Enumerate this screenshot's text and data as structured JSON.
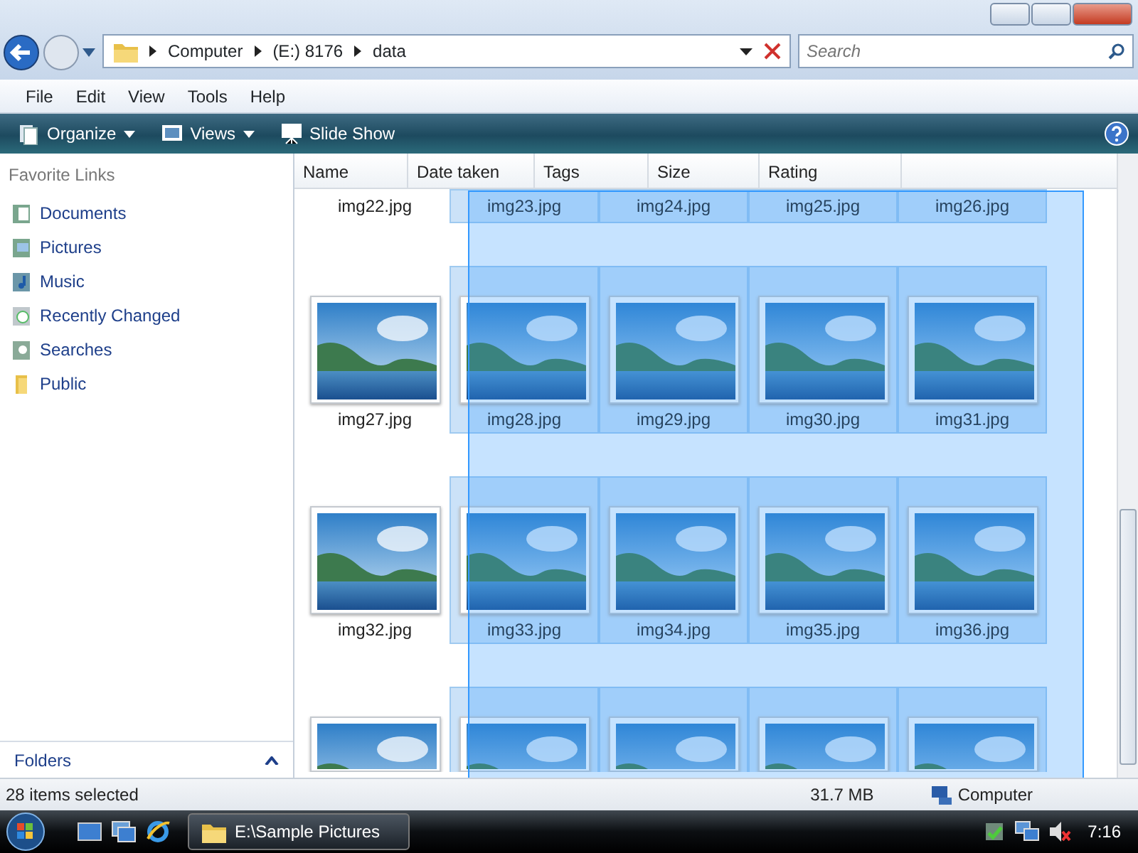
{
  "address_bar": {
    "crumbs": [
      "Computer",
      "(E:) 8176",
      "data"
    ]
  },
  "search": {
    "placeholder": "Search"
  },
  "menu": [
    "File",
    "Edit",
    "View",
    "Tools",
    "Help"
  ],
  "toolbar": [
    "Organize",
    "Views",
    "Slide Show"
  ],
  "sidebar": {
    "title": "Favorite Links",
    "items": [
      {
        "label": "Documents",
        "kind": "documents"
      },
      {
        "label": "Pictures",
        "kind": "pictures"
      },
      {
        "label": "Music",
        "kind": "music"
      },
      {
        "label": "Recently Changed",
        "kind": "recent"
      },
      {
        "label": "Searches",
        "kind": "searches"
      },
      {
        "label": "Public",
        "kind": "folder"
      }
    ],
    "folders": "Folders"
  },
  "columns": [
    "Name",
    "Date taken",
    "Tags",
    "Size",
    "Rating"
  ],
  "rows": [
    {
      "kind": "label-only",
      "items": [
        {
          "label": "img22.jpg",
          "selected": false
        },
        {
          "label": "img23.jpg",
          "selected": true
        },
        {
          "label": "img24.jpg",
          "selected": true
        },
        {
          "label": "img25.jpg",
          "selected": true
        },
        {
          "label": "img26.jpg",
          "selected": true
        }
      ]
    },
    {
      "kind": "full",
      "items": [
        {
          "label": "img27.jpg",
          "selected": false
        },
        {
          "label": "img28.jpg",
          "selected": true
        },
        {
          "label": "img29.jpg",
          "selected": true
        },
        {
          "label": "img30.jpg",
          "selected": true
        },
        {
          "label": "img31.jpg",
          "selected": true
        }
      ]
    },
    {
      "kind": "full",
      "items": [
        {
          "label": "img32.jpg",
          "selected": false
        },
        {
          "label": "img33.jpg",
          "selected": true
        },
        {
          "label": "img34.jpg",
          "selected": true
        },
        {
          "label": "img35.jpg",
          "selected": true
        },
        {
          "label": "img36.jpg",
          "selected": true
        }
      ]
    },
    {
      "kind": "cut",
      "items": [
        {
          "selected": false
        },
        {
          "selected": true
        },
        {
          "selected": true
        },
        {
          "selected": true
        },
        {
          "selected": true
        }
      ]
    }
  ],
  "status_bar": {
    "selection": "28 items selected",
    "size": "31.7 MB",
    "location": "Computer"
  },
  "taskbar": {
    "task": "E:\\Sample Pictures",
    "clock": "7:16"
  }
}
